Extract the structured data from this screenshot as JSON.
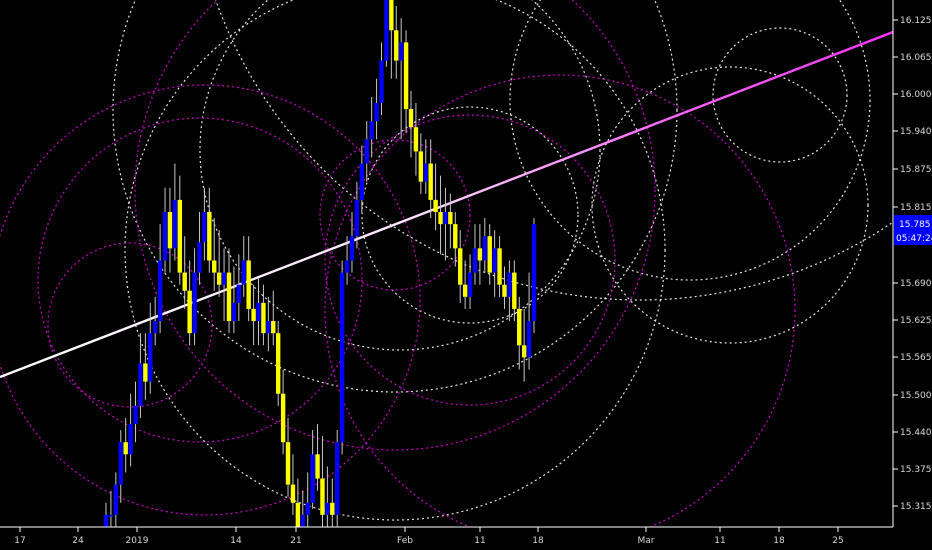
{
  "chart_data": {
    "type": "candlestick",
    "title": "",
    "xlabel": "",
    "ylabel": "",
    "ylim": [
      15.28,
      16.15
    ],
    "grid": false,
    "legend": "none",
    "colors": {
      "background": "#000000",
      "bull_candle": "#0000ff",
      "bear_candle": "#ffff00",
      "wick": "#c8c8c8",
      "trendline_start": "#ffffff",
      "trendline_end": "#ff33ff",
      "circle_white": "#e6e6e6",
      "circle_magenta": "#cc00cc",
      "axis": "#ffffff",
      "price_badge": "#0000ff"
    },
    "y_ticks": [
      "16.125",
      "16.065",
      "16.000",
      "15.940",
      "15.875",
      "15.815",
      "15.690",
      "15.625",
      "15.565",
      "15.500",
      "15.440",
      "15.375",
      "15.315"
    ],
    "x_ticks": [
      "17",
      "24",
      "2019",
      "14",
      "21",
      "Feb",
      "11",
      "18",
      "Mar",
      "11",
      "18",
      "25"
    ],
    "price_badge": {
      "price": "15.785",
      "countdown": "05:47:24"
    },
    "candles_open": [
      15.25,
      15.3,
      15.3,
      15.35,
      15.42,
      15.4,
      15.45,
      15.48,
      15.55,
      15.52,
      15.6,
      15.62,
      15.72,
      15.8,
      15.74,
      15.82,
      15.7,
      15.67,
      15.6,
      15.7,
      15.75,
      15.8,
      15.72,
      15.7,
      15.68,
      15.7,
      15.62,
      15.65,
      15.68,
      15.72,
      15.64,
      15.62,
      15.65,
      15.6,
      15.62,
      15.6,
      15.5,
      15.42,
      15.35,
      15.32,
      15.28,
      15.3,
      15.32,
      15.4,
      15.36,
      15.3,
      15.32,
      15.3,
      15.42,
      15.7,
      15.72,
      15.76,
      15.82,
      15.88,
      15.92,
      15.95,
      15.98,
      16.05,
      16.15,
      16.1,
      16.05,
      16.08,
      15.97,
      15.94,
      15.9,
      15.85,
      15.88,
      15.82,
      15.8,
      15.78,
      15.8,
      15.78,
      15.74,
      15.68,
      15.66,
      15.7,
      15.74,
      15.72,
      15.76,
      15.7,
      15.74,
      15.68,
      15.66,
      15.7,
      15.64,
      15.58,
      15.56,
      15.62
    ],
    "candles_high": [
      15.32,
      15.34,
      15.37,
      15.44,
      15.46,
      15.5,
      15.52,
      15.6,
      15.6,
      15.65,
      15.66,
      15.78,
      15.84,
      15.84,
      15.88,
      15.86,
      15.76,
      15.72,
      15.74,
      15.8,
      15.84,
      15.84,
      15.79,
      15.77,
      15.74,
      15.74,
      15.71,
      15.73,
      15.76,
      15.76,
      15.68,
      15.69,
      15.68,
      15.66,
      15.67,
      15.62,
      15.54,
      15.46,
      15.4,
      15.36,
      15.34,
      15.37,
      15.44,
      15.45,
      15.43,
      15.38,
      15.36,
      15.44,
      15.72,
      15.76,
      15.8,
      15.85,
      15.91,
      15.95,
      15.99,
      16.02,
      16.08,
      16.18,
      16.2,
      16.14,
      16.12,
      16.1,
      16.0,
      15.98,
      15.93,
      15.92,
      15.92,
      15.88,
      15.86,
      15.84,
      15.83,
      15.8,
      15.77,
      15.72,
      15.73,
      15.78,
      15.78,
      15.79,
      15.78,
      15.77,
      15.76,
      15.71,
      15.72,
      15.72,
      15.66,
      15.64,
      15.7,
      15.79
    ],
    "candles_low": [
      15.22,
      15.26,
      15.27,
      15.32,
      15.37,
      15.38,
      15.42,
      15.46,
      15.49,
      15.5,
      15.58,
      15.6,
      15.7,
      15.7,
      15.72,
      15.68,
      15.64,
      15.58,
      15.58,
      15.68,
      15.72,
      15.7,
      15.67,
      15.66,
      15.62,
      15.6,
      15.6,
      15.62,
      15.66,
      15.62,
      15.58,
      15.58,
      15.58,
      15.57,
      15.58,
      15.48,
      15.4,
      15.33,
      15.3,
      15.26,
      15.25,
      15.28,
      15.31,
      15.34,
      15.28,
      15.27,
      15.28,
      15.28,
      15.4,
      15.68,
      15.7,
      15.74,
      15.8,
      15.85,
      15.89,
      15.92,
      15.96,
      16.04,
      16.02,
      16.02,
      15.92,
      15.93,
      15.89,
      15.86,
      15.83,
      15.83,
      15.79,
      15.77,
      15.73,
      15.72,
      15.74,
      15.71,
      15.65,
      15.64,
      15.64,
      15.68,
      15.68,
      15.7,
      15.68,
      15.66,
      15.66,
      15.64,
      15.62,
      15.62,
      15.54,
      15.52,
      15.54,
      15.6
    ],
    "candles_close": [
      15.3,
      15.3,
      15.35,
      15.42,
      15.4,
      15.45,
      15.48,
      15.55,
      15.52,
      15.6,
      15.62,
      15.72,
      15.8,
      15.74,
      15.82,
      15.7,
      15.67,
      15.6,
      15.7,
      15.75,
      15.8,
      15.72,
      15.7,
      15.68,
      15.7,
      15.62,
      15.65,
      15.68,
      15.72,
      15.64,
      15.62,
      15.65,
      15.6,
      15.62,
      15.6,
      15.5,
      15.42,
      15.35,
      15.32,
      15.28,
      15.3,
      15.32,
      15.4,
      15.36,
      15.3,
      15.32,
      15.3,
      15.42,
      15.7,
      15.72,
      15.76,
      15.82,
      15.88,
      15.92,
      15.95,
      15.98,
      16.05,
      16.15,
      16.1,
      16.05,
      16.08,
      15.97,
      15.94,
      15.9,
      15.85,
      15.88,
      15.82,
      15.8,
      15.78,
      15.8,
      15.78,
      15.74,
      15.68,
      15.66,
      15.7,
      15.74,
      15.72,
      15.76,
      15.7,
      15.74,
      15.68,
      15.66,
      15.7,
      15.64,
      15.58,
      15.56,
      15.62,
      15.78
    ]
  }
}
